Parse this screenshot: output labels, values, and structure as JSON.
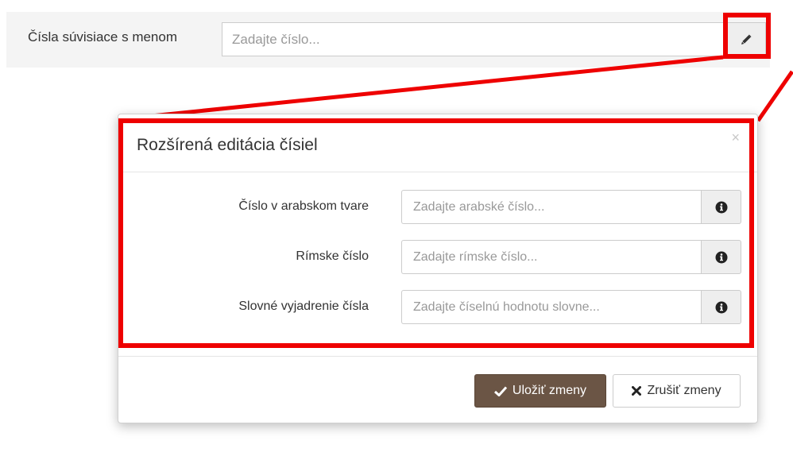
{
  "field": {
    "label": "Čísla súvisiace s menom",
    "placeholder": "Zadajte číslo..."
  },
  "edit_button": {
    "icon": "pencil-icon"
  },
  "modal": {
    "title": "Rozšírená editácia čísiel",
    "close_symbol": "×",
    "rows": [
      {
        "label": "Číslo v arabskom tvare",
        "placeholder": "Zadajte arabské číslo...",
        "icon": "info-icon"
      },
      {
        "label": "Rímske číslo",
        "placeholder": "Zadajte rímske číslo...",
        "icon": "info-icon"
      },
      {
        "label": "Slovné vyjadrenie čísla",
        "placeholder": "Zadajte číselnú hodnotu slovne...",
        "icon": "info-icon"
      }
    ],
    "save_label": "Uložiť zmeny",
    "cancel_label": "Zrušiť zmeny"
  },
  "colors": {
    "highlight": "#ee0000",
    "save_button": "#6b5545",
    "row_background": "#f4f4f4"
  }
}
